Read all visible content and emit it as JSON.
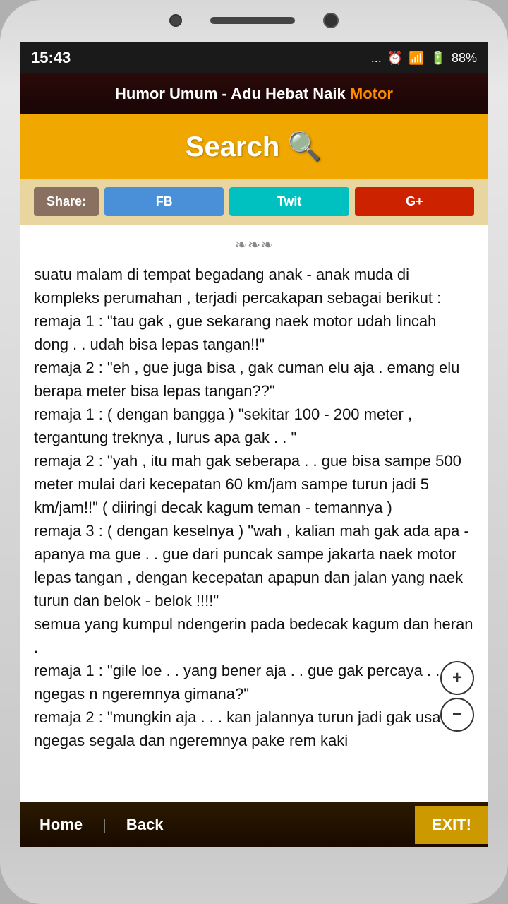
{
  "status": {
    "time": "15:43",
    "battery": "88%",
    "signal": "●●●●",
    "dots": "..."
  },
  "title": {
    "text_before": "Humor Umum - Adu Hebat Naik ",
    "text_highlight": "Motor"
  },
  "search": {
    "label": "Search 🔍"
  },
  "share": {
    "label": "Share:",
    "fb": "FB",
    "twit": "Twit",
    "gplus": "G+"
  },
  "ornament": "❧❧❧",
  "content": "suatu malam di tempat begadang anak - anak muda di kompleks perumahan , terjadi percakapan sebagai berikut :\nremaja 1 : \"tau gak , gue sekarang naek motor udah lincah dong . . udah bisa lepas tangan!!\"\nremaja 2 : \"eh , gue juga bisa , gak cuman elu aja . emang elu berapa meter bisa lepas tangan??\"\nremaja 1 : ( dengan bangga ) \"sekitar 100 - 200 meter , tergantung treknya , lurus apa gak . . \"\nremaja 2 : \"yah , itu mah gak seberapa . . gue bisa sampe 500 meter mulai dari kecepatan 60 km/jam sampe turun jadi 5 km/jam!!\" ( diiringi decak kagum teman - temannya )\nremaja 3 : ( dengan keselnya ) \"wah , kalian mah gak ada apa - apanya ma gue . . gue dari puncak sampe jakarta naek motor lepas tangan , dengan kecepatan apapun dan jalan yang naek turun dan belok - belok !!!!\"\nsemua yang kumpul ndengerin pada bedecak kagum dan heran .\nremaja 1 : \"gile loe . . yang bener aja . . gue gak percaya . . ngegas n ngeremnya gimana?\"\nremaja 2 : \"mungkin aja . . . kan jalannya turun jadi gak usah ngegas segala dan ngeremnya pake rem kaki",
  "bottom": {
    "home": "Home",
    "back": "Back",
    "exit": "EXIT!"
  },
  "zoom": {
    "in": "+",
    "out": "−"
  }
}
